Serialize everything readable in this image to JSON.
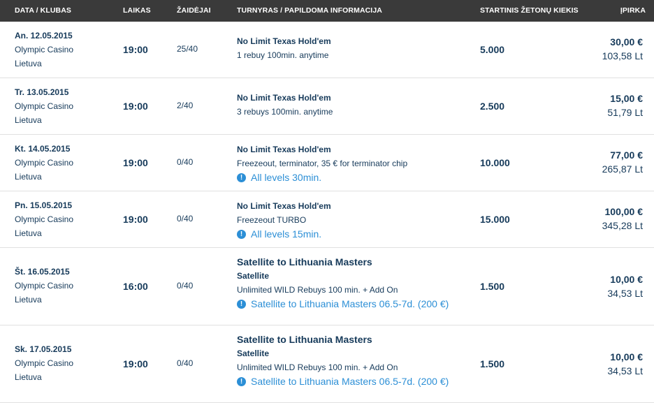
{
  "header": {
    "date_club": "DATA / KLUBAS",
    "time": "LAIKAS",
    "players": "ŽAIDĖJAI",
    "tournament": "TURNYRAS / PAPILDOMA INFORMACIJA",
    "chips": "STARTINIS ŽETONŲ KIEKIS",
    "buyin": "ĮPIRKA"
  },
  "rows": [
    {
      "date": "An. 12.05.2015",
      "club": "Olympic Casino",
      "country": "Lietuva",
      "time": "19:00",
      "players": "25/40",
      "name": "No Limit Texas Hold'em",
      "info": "1 rebuy 100min. anytime",
      "chips": "5.000",
      "price_eur": "30,00 €",
      "price_lt": "103,58 Lt"
    },
    {
      "date": "Tr. 13.05.2015",
      "club": "Olympic Casino",
      "country": "Lietuva",
      "time": "19:00",
      "players": "2/40",
      "name": "No Limit Texas Hold'em",
      "info": "3 rebuys 100min. anytime",
      "chips": "2.500",
      "price_eur": "15,00 €",
      "price_lt": "51,79 Lt"
    },
    {
      "date": "Kt. 14.05.2015",
      "club": "Olympic Casino",
      "country": "Lietuva",
      "time": "19:00",
      "players": "0/40",
      "name": "No Limit Texas Hold'em",
      "info": "Freezeout, terminator, 35 € for terminator chip",
      "note": "All levels 30min.",
      "chips": "10.000",
      "price_eur": "77,00 €",
      "price_lt": "265,87 Lt"
    },
    {
      "date": "Pn. 15.05.2015",
      "club": "Olympic Casino",
      "country": "Lietuva",
      "time": "19:00",
      "players": "0/40",
      "name": "No Limit Texas Hold'em",
      "info": "Freezeout TURBO",
      "note": "All levels 15min.",
      "chips": "15.000",
      "price_eur": "100,00 €",
      "price_lt": "345,28 Lt"
    },
    {
      "date": "Št. 16.05.2015",
      "club": "Olympic Casino",
      "country": "Lietuva",
      "time": "16:00",
      "players": "0/40",
      "name": "Satellite to Lithuania Masters",
      "sub": "Satellite",
      "info": "Unlimited WILD Rebuys 100 min. + Add On",
      "note": "Satellite to Lithuania Masters 06.5-7d. (200 €)",
      "chips": "1.500",
      "price_eur": "10,00 €",
      "price_lt": "34,53 Lt"
    },
    {
      "date": "Sk. 17.05.2015",
      "club": "Olympic Casino",
      "country": "Lietuva",
      "time": "19:00",
      "players": "0/40",
      "name": "Satellite to Lithuania Masters",
      "sub": "Satellite",
      "info": "Unlimited WILD Rebuys 100 min. + Add On",
      "note": "Satellite to Lithuania Masters 06.5-7d. (200 €)",
      "chips": "1.500",
      "price_eur": "10,00 €",
      "price_lt": "34,53 Lt"
    }
  ]
}
